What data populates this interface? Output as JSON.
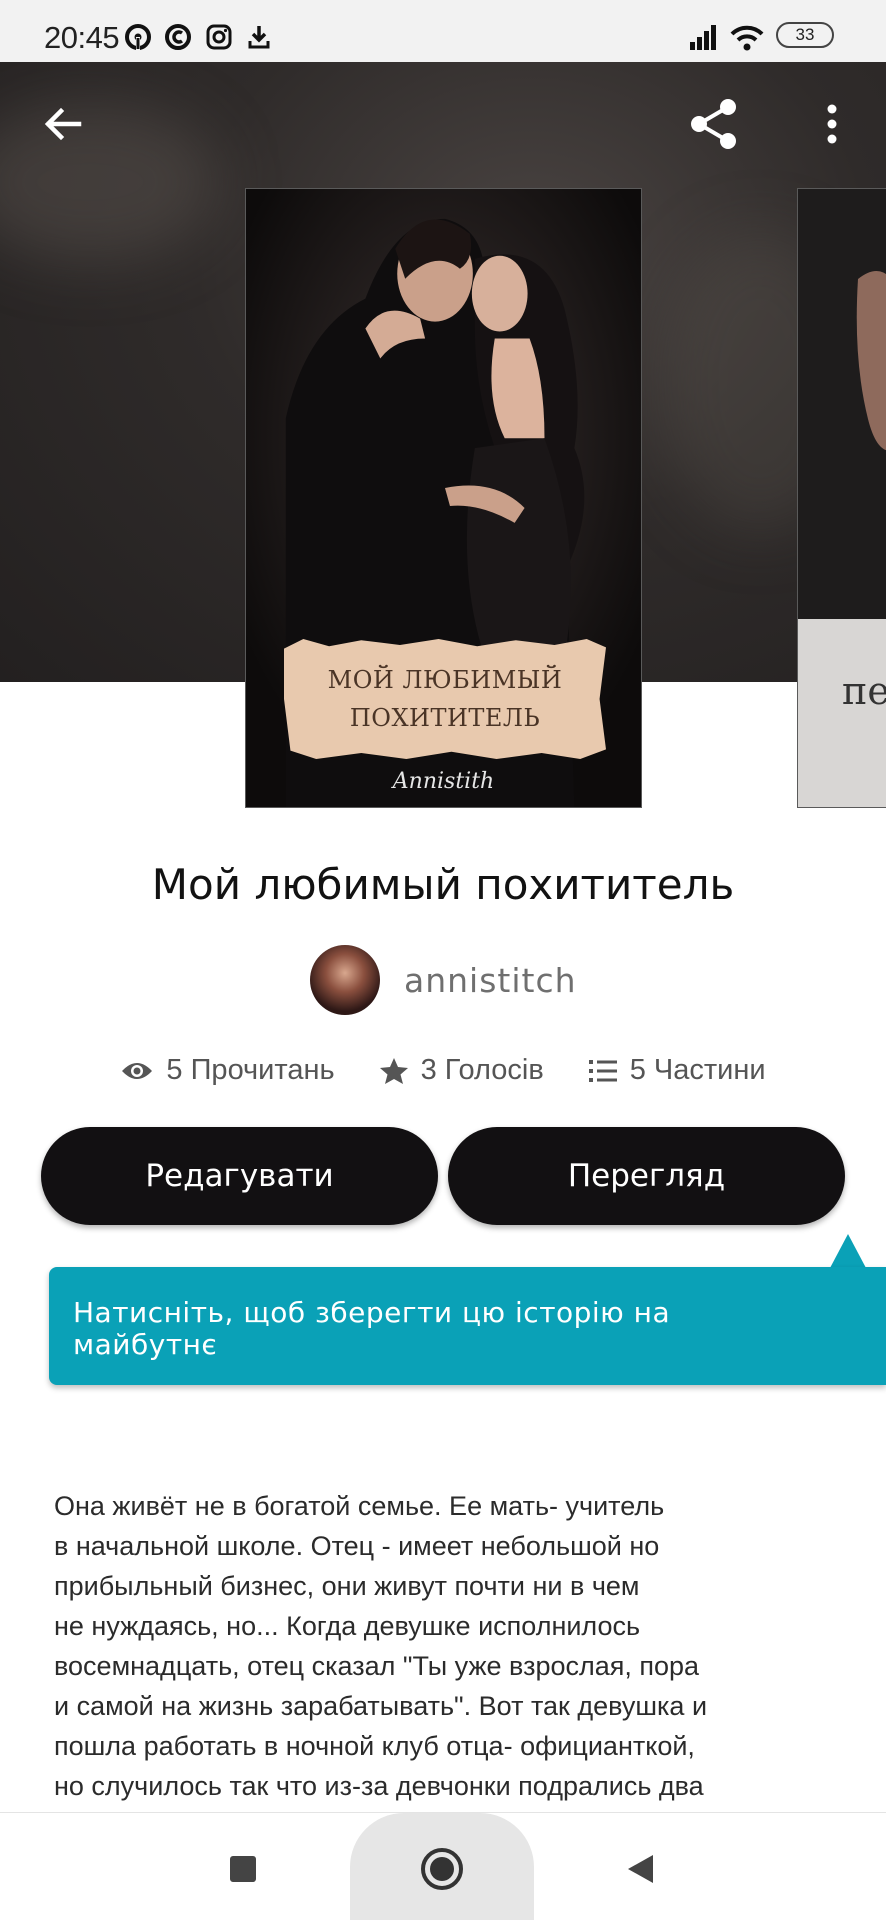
{
  "status_bar": {
    "time": "20:45",
    "battery": "33",
    "icons": [
      "hotspot-icon",
      "c-app-icon",
      "instagram-icon",
      "download-icon",
      "signal-icon",
      "wifi-icon",
      "battery-icon"
    ]
  },
  "header": {
    "back_icon": "arrow-left-icon",
    "share_icon": "share-icon",
    "more_icon": "more-vertical-icon"
  },
  "cover": {
    "title_line1": "МОЙ ЛЮБИМЫЙ",
    "title_line2": "ПОХИТИТЕЛЬ",
    "author_signature": "Annistith",
    "next_cover_partial_text": "пе"
  },
  "story": {
    "title": "Мой любимый похититель",
    "author": "annistitch"
  },
  "stats": {
    "reads": "5 Прочитань",
    "votes": "3 Голосів",
    "parts": "5 Частини"
  },
  "actions": {
    "edit_label": "Редагувати",
    "preview_label": "Перегляд"
  },
  "tooltip": {
    "text": "Натисніть, щоб зберегти цю історію на майбутнє"
  },
  "description": {
    "text": "Она живёт не в богатой семье. Ее мать- учитель\nв начальной школе. Отец - имеет небольшой но\nприбыльный бизнес, они живут почти ни в чем\nне нуждаясь, но... Когда девушке исполнилось\nвосемнадцать, отец сказал \"Ты уже взрослая, пора\nи самой на жизнь зарабатывать\". Вот так девушка и\nпошла работать  в ночной клуб отца- официанткой,\nно случилось так что из-за девчонки подрались два"
  },
  "colors": {
    "button_bg": "#121012",
    "tooltip_bg": "#0aa1b7",
    "hero_bg": "#2f2b2a"
  }
}
